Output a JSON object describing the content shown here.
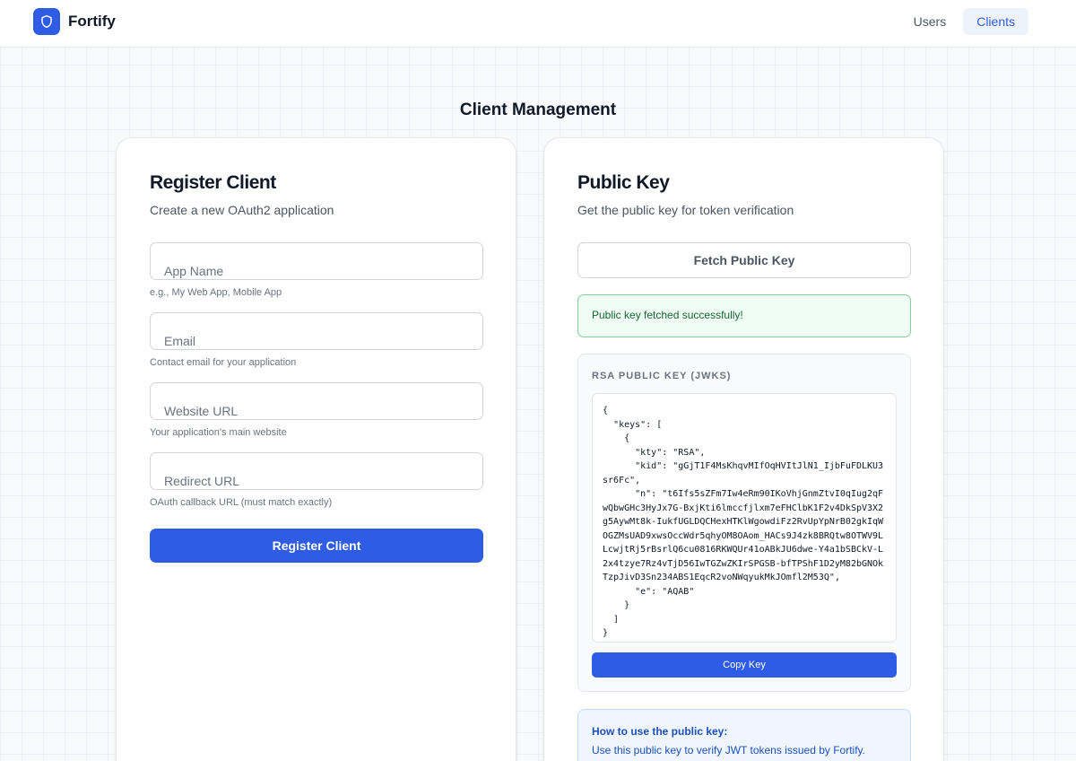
{
  "header": {
    "brand_name": "Fortify",
    "nav": [
      {
        "label": "Users",
        "active": false
      },
      {
        "label": "Clients",
        "active": true
      }
    ]
  },
  "page": {
    "title": "Client Management"
  },
  "register_card": {
    "title": "Register Client",
    "subtitle": "Create a new OAuth2 application",
    "fields": [
      {
        "label": "App Name",
        "value": "",
        "helper": "e.g., My Web App, Mobile App"
      },
      {
        "label": "Email",
        "value": "",
        "helper": "Contact email for your application"
      },
      {
        "label": "Website URL",
        "value": "",
        "helper": "Your application's main website"
      },
      {
        "label": "Redirect URL",
        "value": "",
        "helper": "OAuth callback URL (must match exactly)"
      }
    ],
    "submit_label": "Register Client"
  },
  "public_key_card": {
    "title": "Public Key",
    "subtitle": "Get the public key for token verification",
    "fetch_label": "Fetch Public Key",
    "success_message": "Public key fetched successfully!",
    "panel_title": "RSA PUBLIC KEY (JWKS)",
    "jwks": "{\n  \"keys\": [\n    {\n      \"kty\": \"RSA\",\n      \"kid\": \"gGjT1F4MsKhqvMIfOqHVItJlN1_IjbFuFDLKU3sr6Fc\",\n      \"n\": \"t6Ifs5sZFm7Iw4eRm90IKoVhjGnmZtvI0qIug2qFwQbwGHc3HyJx7G-BxjKti6lmccfjlxm7eFHClbK1F2v4DkSpV3X2g5AywMt8k-IukfUGLDQCHexHTKlWgowdiFz2RvUpYpNrB02gkIqWOGZMsUAD9xwsOccWdr5qhyOM8OAom_HACs9J4zk8BRQtw8OTWV9LLcwjtRj5rBsrlQ6cu0816RKWQUr41oABkJU6dwe-Y4a1bSBCkV-L2x4tzye7Rz4vTjD56IwTGZwZKIrSPGSB-bfTPShF1D2yM82bGNOkTzpJivD3Sn234ABS1EqcR2voNWqyukMkJOmfl2M53Q\",\n      \"e\": \"AQAB\"\n    }\n  ]\n}",
    "copy_label": "Copy Key",
    "info_title": "How to use the public key:",
    "info_text": "Use this public key to verify JWT tokens issued by Fortify."
  },
  "colors": {
    "primary": "#2f5ce6",
    "success_bg": "#f0fdf4",
    "success_border": "#86d19a",
    "info_bg": "#eff6ff",
    "info_text": "#1e4fb8"
  },
  "icons": {
    "logo": "shield-icon"
  }
}
